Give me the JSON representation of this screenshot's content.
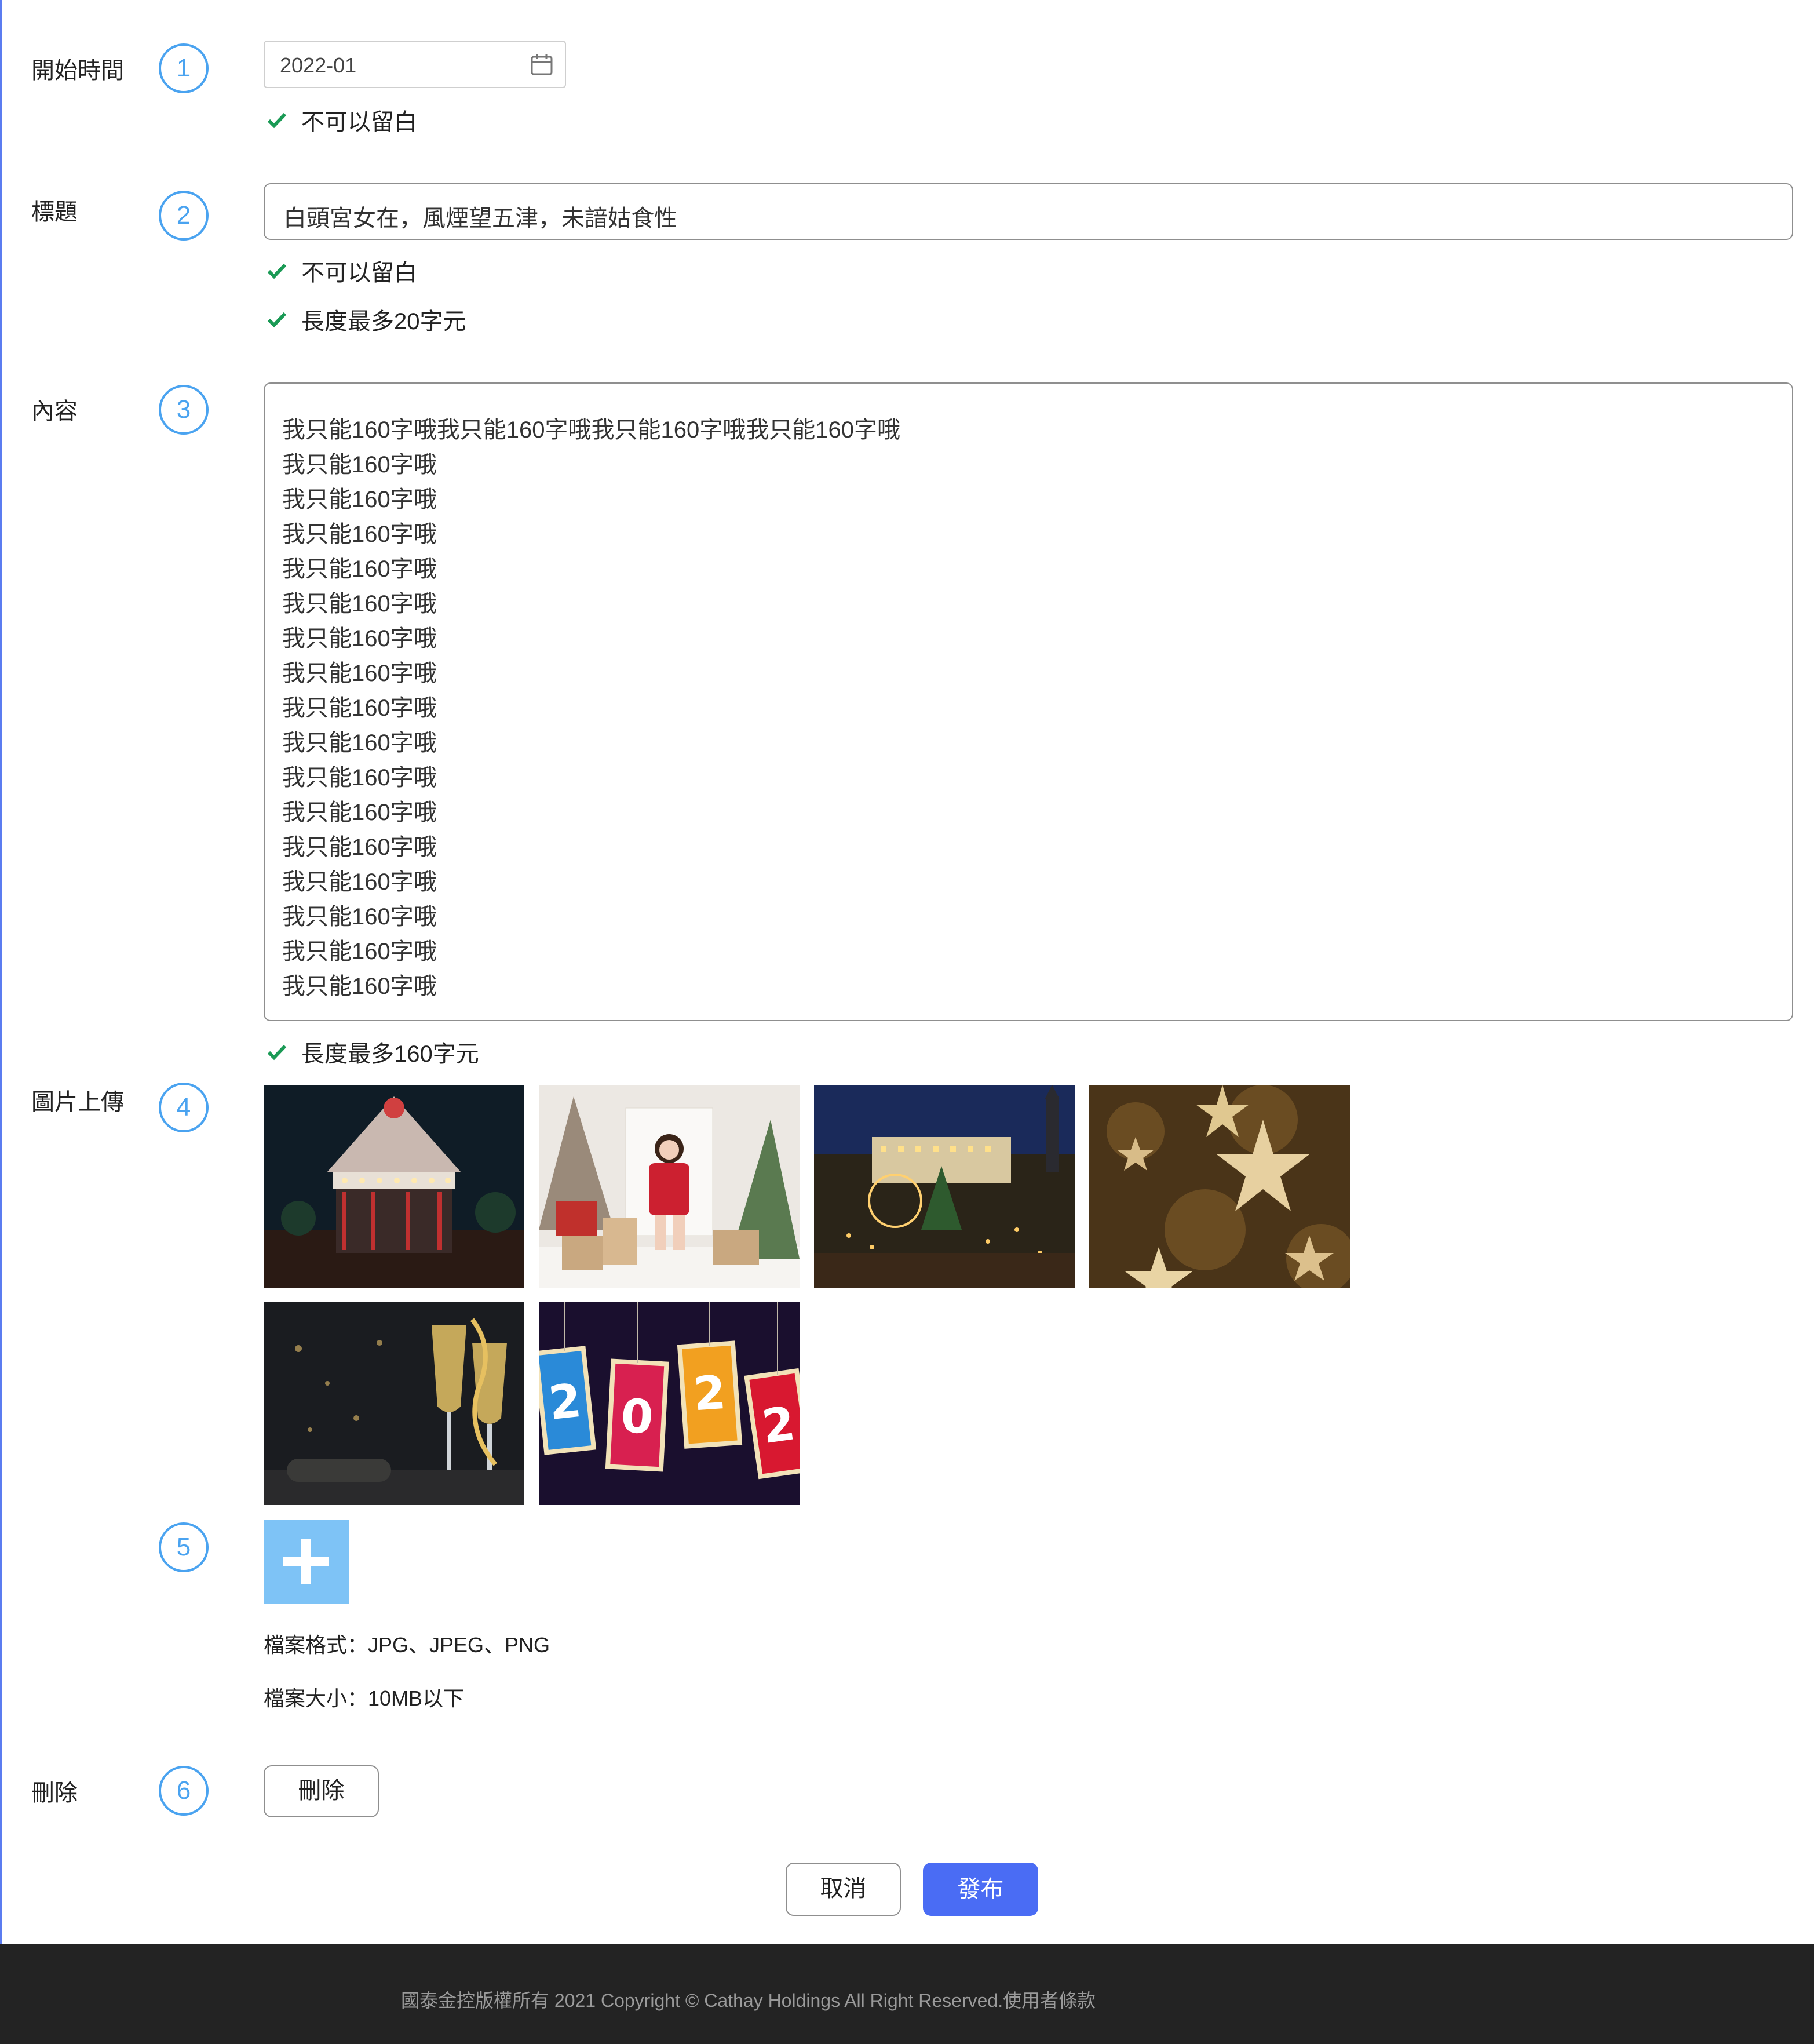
{
  "form": {
    "start_time": {
      "label": "開始時間",
      "step": "1",
      "value": "2022-01",
      "validations": [
        "不可以留白"
      ]
    },
    "title": {
      "label": "標題",
      "step": "2",
      "value": "白頭宮女在，風煙望五津，未諳姑食性",
      "validations": [
        "不可以留白",
        "長度最多20字元"
      ]
    },
    "content": {
      "label": "內容",
      "step": "3",
      "lines": [
        "我只能160字哦我只能160字哦我只能160字哦我只能160字哦",
        "我只能160字哦",
        "我只能160字哦",
        "我只能160字哦",
        "我只能160字哦",
        "我只能160字哦",
        "我只能160字哦",
        "我只能160字哦",
        "我只能160字哦",
        "我只能160字哦",
        "我只能160字哦",
        "我只能160字哦",
        "我只能160字哦",
        "我只能160字哦",
        "我只能160字哦",
        "我只能160字哦",
        "我只能160字哦"
      ],
      "validations": [
        "長度最多160字元"
      ]
    },
    "images": {
      "label": "圖片上傳",
      "step": "4",
      "thumbnails": [
        {
          "name": "carousel-night-photo"
        },
        {
          "name": "christmas-woman-photo"
        },
        {
          "name": "christmas-market-photo"
        },
        {
          "name": "gold-stars-photo"
        },
        {
          "name": "champagne-glasses-photo"
        },
        {
          "name": "2022-tags-photo"
        }
      ],
      "tag_digits": [
        "2",
        "0",
        "2",
        "2"
      ]
    },
    "upload": {
      "step": "5",
      "format_note": "檔案格式：JPG、JPEG、PNG",
      "size_note": "檔案大小：10MB以下"
    },
    "delete": {
      "label": "刪除",
      "step": "6",
      "button_label": "刪除"
    },
    "actions": {
      "cancel_label": "取消",
      "publish_label": "發布"
    }
  },
  "footer": {
    "text": "國泰金控版權所有 2021 Copyright © Cathay Holdings All Right Reserved.使用者條款"
  },
  "colors": {
    "accent_blue": "#4aa3f0",
    "check_green": "#1a9a55",
    "primary_button": "#4a6cf4",
    "upload_tile": "#7ec3f6",
    "footer_bg": "#232323"
  }
}
